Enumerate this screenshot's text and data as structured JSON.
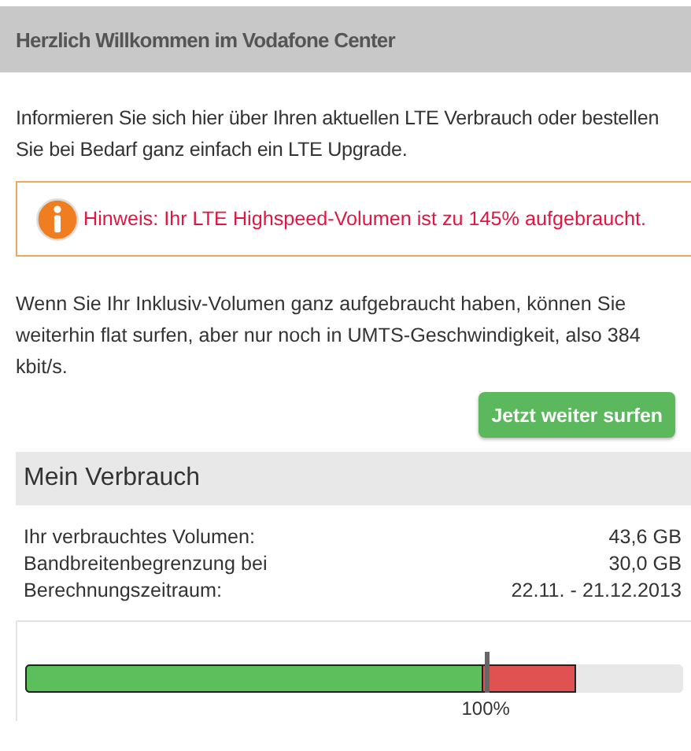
{
  "header": {
    "title": "Herzlich Willkommen im Vodafone Center"
  },
  "intro": "Informieren Sie sich hier über Ihren aktuellen LTE Verbrauch oder bestellen Sie bei Bedarf ganz einfach ein LTE Upgrade.",
  "notice": {
    "text": "Hinweis: Ihr LTE Highspeed-Volumen ist zu 145% aufgebraucht."
  },
  "info": "Wenn Sie Ihr Inklusiv-Volumen ganz aufgebraucht haben, können Sie weiterhin flat surfen, aber nur noch in UMTS-Geschwindigkeit, also 384 kbit/s.",
  "button": "Jetzt weiter surfen",
  "usage": {
    "title": "Mein Verbrauch",
    "rows": [
      {
        "label": "Ihr verbrauchtes Volumen:",
        "value": "43,6 GB"
      },
      {
        "label": "Bandbreitenbegrenzung bei",
        "value": "30,0 GB"
      },
      {
        "label": "Berechnungszeitraum:",
        "value": "22.11. - 21.12.2013"
      }
    ],
    "bar": {
      "level": 0.837,
      "limit": {
        "level": 0.7,
        "label": "100%"
      }
    }
  }
}
